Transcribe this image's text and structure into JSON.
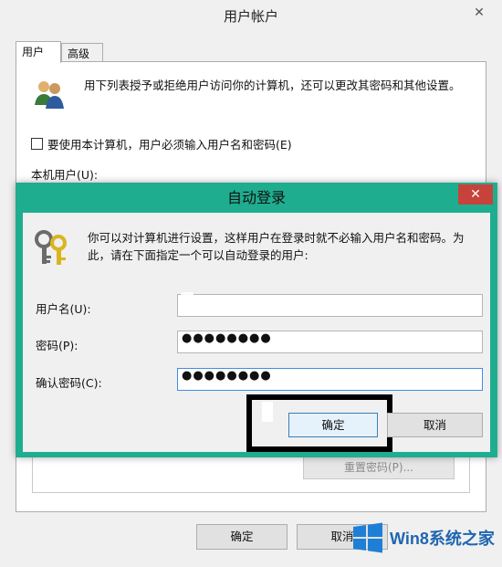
{
  "back_window": {
    "title": "用户帐户",
    "close_glyph": "✕",
    "tabs": [
      {
        "label": "用户",
        "active": true
      },
      {
        "label": "高级",
        "active": false
      }
    ],
    "intro_text": "用下列表授予或拒绝用户访问你的计算机，还可以更改其密码和其他设置。",
    "require_login_checkbox": {
      "label": "要使用本计算机，用户必须输入用户名和密码(E)",
      "checked": false
    },
    "local_users_label": "本机用户(U):",
    "reset_password_label": "重置密码(P)...",
    "ok_label": "确定",
    "cancel_label": "取消"
  },
  "dialog": {
    "title": "自动登录",
    "close_glyph": "✕",
    "description": "你可以对计算机进行设置，这样用户在登录时就不必输入用户名和密码。为此，请在下面指定一个可以自动登录的用户:",
    "fields": {
      "username": {
        "label": "用户名(U):",
        "value": ""
      },
      "password": {
        "label": "密码(P):",
        "value": "●●●●●●●●"
      },
      "confirm": {
        "label": "确认密码(C):",
        "value": "●●●●●●●●"
      }
    },
    "ok_label": "确定",
    "cancel_label": "取消"
  },
  "watermark": {
    "text": "Win8系统之家"
  },
  "colors": {
    "dialog_frame": "#1fad8f",
    "close_button": "#c7423a",
    "focus_border": "#3d8ee6",
    "watermark_text": "#1f66b1"
  }
}
